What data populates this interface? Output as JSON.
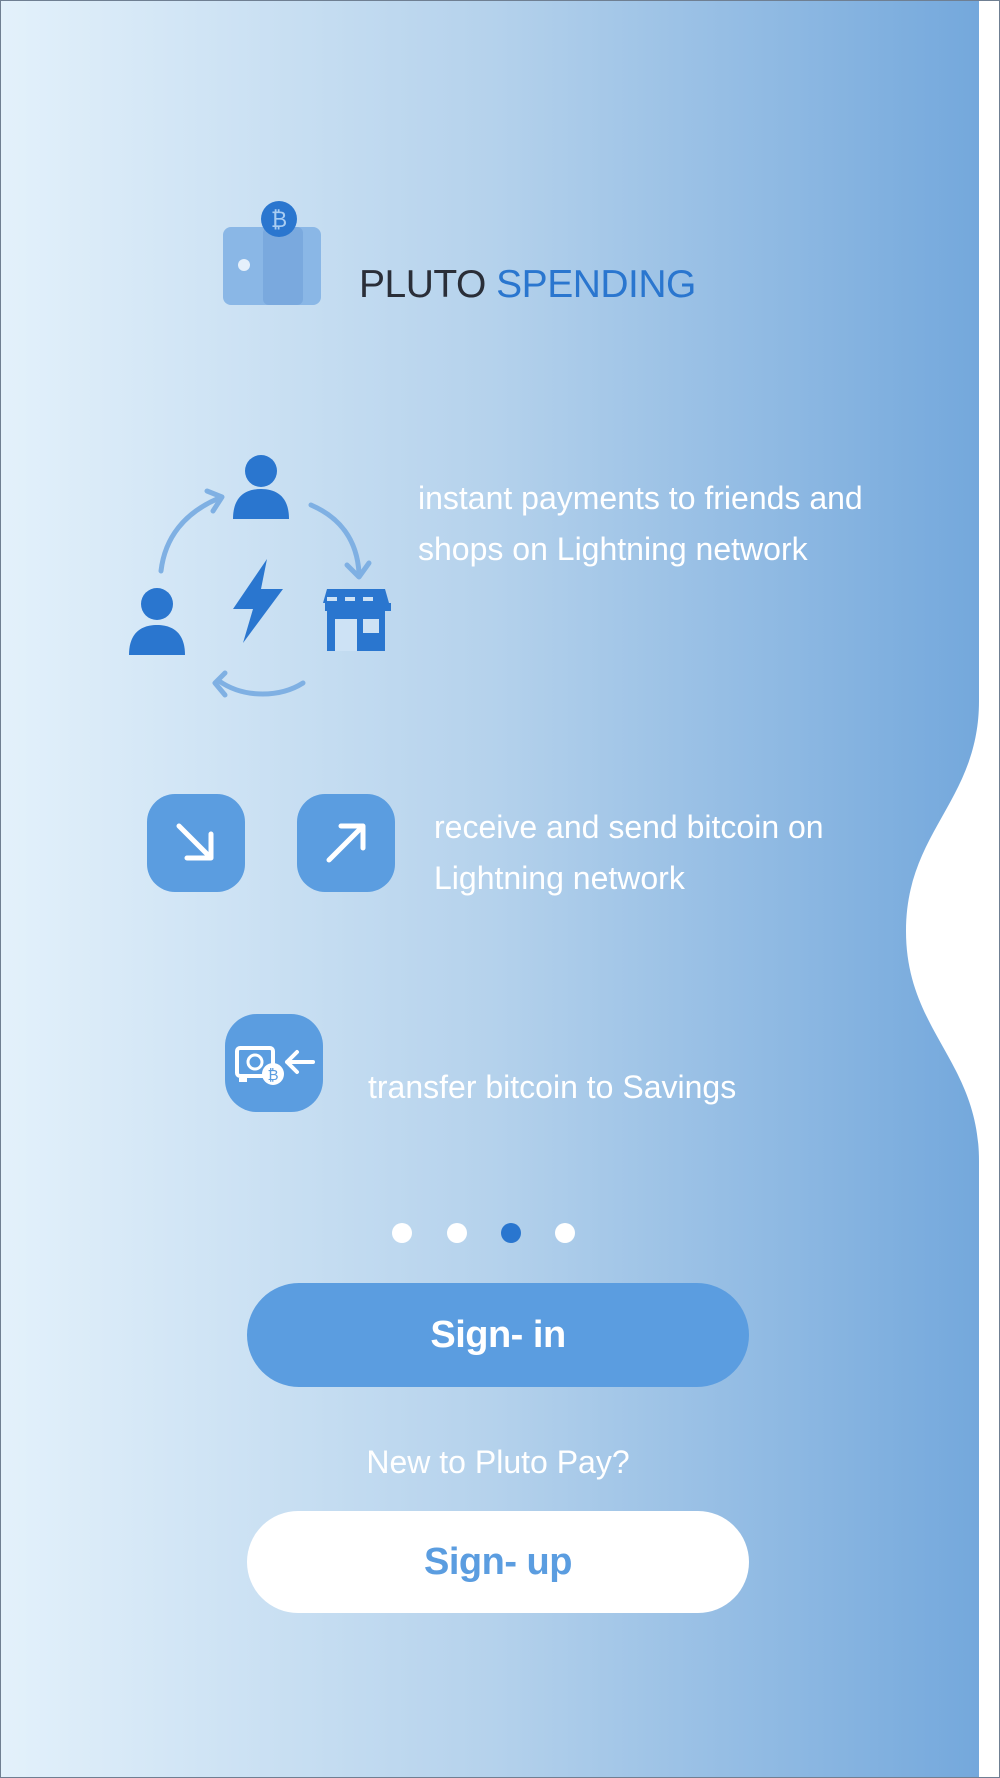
{
  "app": {
    "brand_part1": "PLUTO",
    "brand_part2": "SPENDING"
  },
  "features": [
    {
      "icon": "lightning-payments-cycle-icon",
      "line1": "instant payments to friends and",
      "line2": "shops on Lightning network"
    },
    {
      "icon": "receive-send-arrows-icon",
      "line1": "receive and send bitcoin on",
      "line2": "Lightning network"
    },
    {
      "icon": "savings-transfer-icon",
      "line1": "transfer bitcoin to Savings",
      "line2": ""
    }
  ],
  "pagination": {
    "count": 4,
    "active_index": 2
  },
  "actions": {
    "signin_label": "Sign- in",
    "new_user_prompt": "New to Pluto Pay?",
    "signup_label": "Sign- up"
  },
  "colors": {
    "accent": "#2a76cf",
    "tile": "#5b9de0",
    "gradient_start": "#e3f1fb",
    "gradient_end": "#74a8dc"
  }
}
